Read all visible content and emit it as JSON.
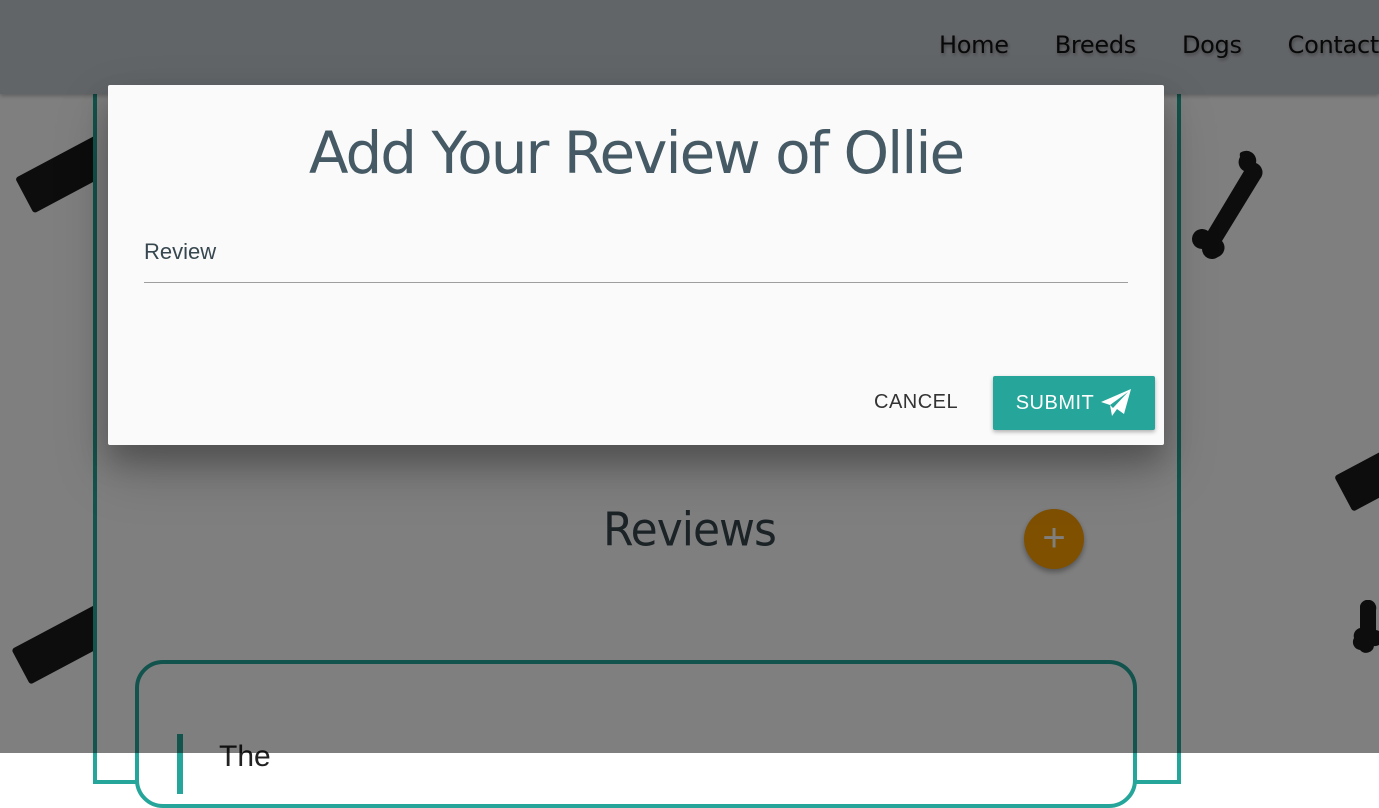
{
  "nav": {
    "items": [
      {
        "label": "Home"
      },
      {
        "label": "Breeds"
      },
      {
        "label": "Dogs"
      },
      {
        "label": "Contact"
      }
    ]
  },
  "modal": {
    "title": "Add Your Review of Ollie",
    "review_label": "Review",
    "review_value": "",
    "cancel_label": "CANCEL",
    "submit_label": "SUBMIT",
    "submit_icon": "paper-plane-icon"
  },
  "page": {
    "reviews_title": "Reviews",
    "add_review_icon": "plus-icon",
    "first_review_text": "The"
  },
  "colors": {
    "teal": "#26a69a",
    "amber": "#ffa000",
    "heading": "#455a64",
    "modal_bg": "#fafafa"
  }
}
